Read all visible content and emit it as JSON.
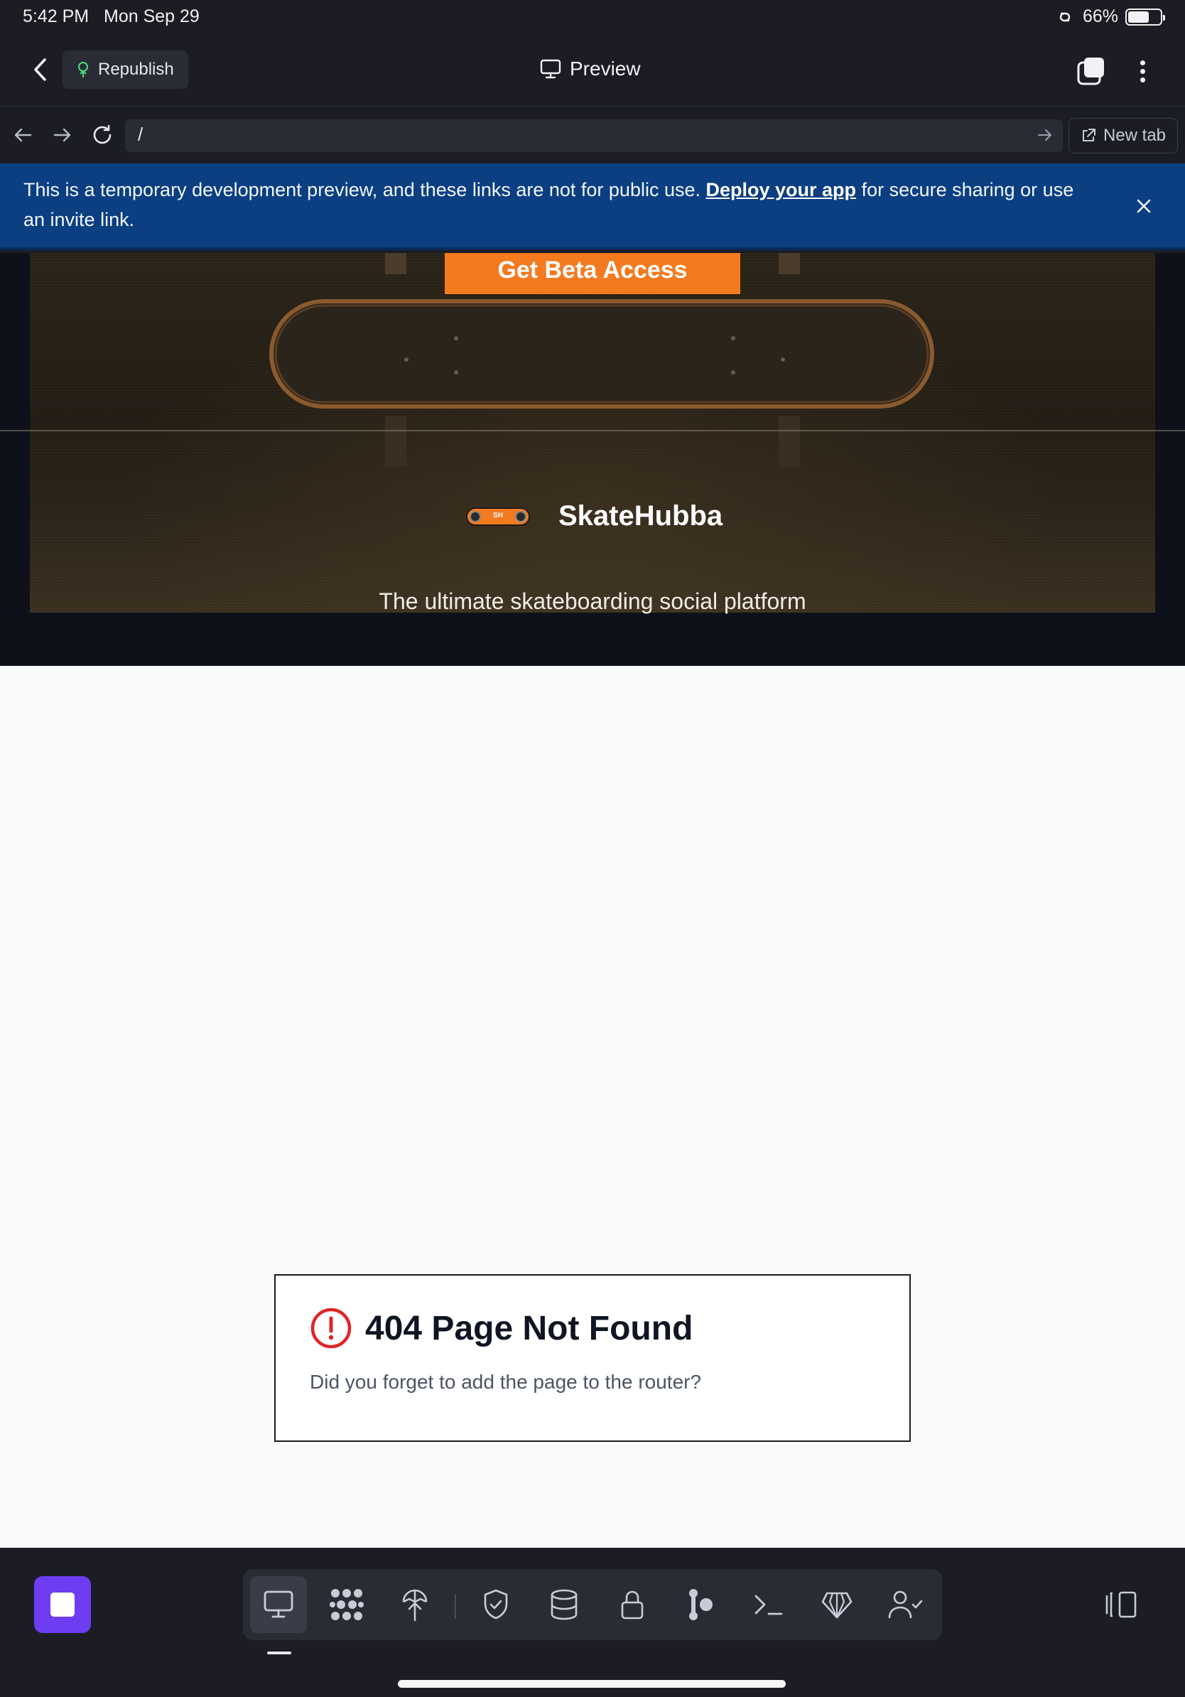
{
  "status_bar": {
    "time": "5:42 PM",
    "date": "Mon Sep 29",
    "battery": "66%",
    "battery_level": 0.66
  },
  "toolbar": {
    "republish_label": "Republish",
    "preview_label": "Preview"
  },
  "url_bar": {
    "url": "/",
    "new_tab_label": "New tab"
  },
  "banner": {
    "text_before": "This is a temporary development preview, and these links are not for public use.",
    "link": "Deploy your app",
    "text_after": "for secure sharing or use an invite link."
  },
  "page": {
    "cta_label": "Get Beta Access",
    "brand_logo_text": "SH",
    "brand_name": "SkateHubba",
    "tagline": "The ultimate skateboarding social platform",
    "error_title": "404 Page Not Found",
    "error_message": "Did you forget to add the page to the router?"
  },
  "dock": {
    "tools": [
      "preview-icon",
      "apps-icon",
      "deploy-icon",
      "security-icon",
      "database-icon",
      "secrets-icon",
      "git-icon",
      "shell-icon",
      "agent-icon",
      "users-icon"
    ],
    "active_tool": "preview-icon"
  },
  "colors": {
    "accent": "#6d3df1",
    "banner": "#0b3f82",
    "cta": "#f47a1f",
    "error": "#dc2626"
  }
}
